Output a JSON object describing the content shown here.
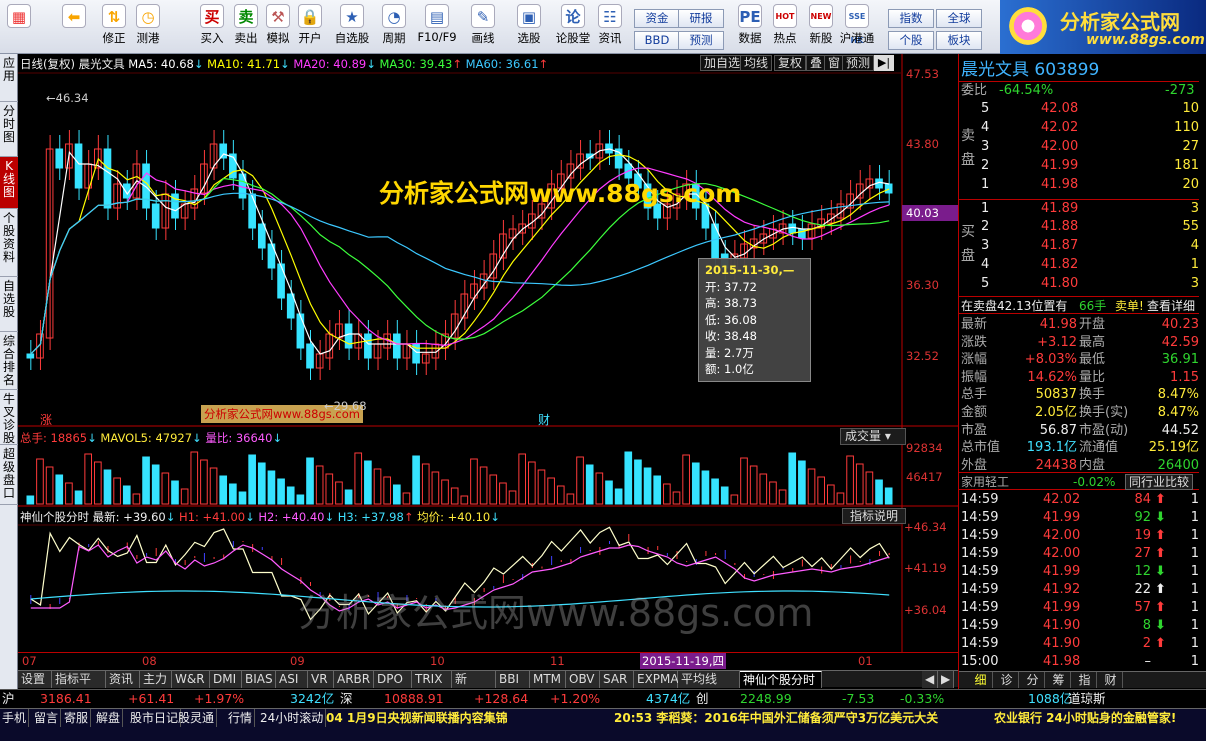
{
  "toolbar": {
    "buttons": [
      {
        "label": "",
        "icon": "app-grid-icon"
      },
      {
        "label": "",
        "icon": "back-arrow-icon"
      },
      {
        "label": "修正",
        "icon": "up-down-icon"
      },
      {
        "label": "测港",
        "icon": "clock-icon"
      },
      {
        "label": "买入",
        "icon": "buy-icon",
        "glyph": "买"
      },
      {
        "label": "卖出",
        "icon": "sell-icon",
        "glyph": "卖"
      },
      {
        "label": "模拟",
        "icon": "hammer-icon"
      },
      {
        "label": "开户",
        "icon": "lock-icon"
      },
      {
        "label": "自选股",
        "icon": "star-icon"
      },
      {
        "label": "周期",
        "icon": "cycle-icon"
      },
      {
        "label": "F10/F9",
        "icon": "f10-icon"
      },
      {
        "label": "画线",
        "icon": "pen-icon"
      },
      {
        "label": "选股",
        "icon": "monitor-icon"
      },
      {
        "label": "论股堂",
        "icon": "forum-icon",
        "glyph": "论"
      },
      {
        "label": "资讯",
        "icon": "news-icon"
      },
      {
        "label": "数据",
        "icon": "pe-icon",
        "glyph": "PE"
      },
      {
        "label": "热点",
        "icon": "hot-icon",
        "glyph": "HOT"
      },
      {
        "label": "新股",
        "icon": "new-stock-icon",
        "glyph": "NEW"
      },
      {
        "label": "沪港通",
        "icon": "sse-hk-icon",
        "glyph": "SSE HK"
      }
    ],
    "small_buttons": [
      "资金",
      "BBD",
      "研报",
      "预测",
      "指数",
      "个股",
      "全球",
      "板块"
    ]
  },
  "logo": {
    "title": "分析家公式网",
    "url": "www.88gs.com"
  },
  "left_tabs": [
    "应用",
    "分时图",
    "K线图",
    "个股资料",
    "自选股",
    "综合排名",
    "牛叉诊股",
    "超级盘口"
  ],
  "main_chart": {
    "header": {
      "period": "日线(复权)",
      "stock": "晨光文具",
      "ma5": "MA5: 40.68",
      "ma10": "MA10: 41.71",
      "ma20": "MA20: 40.89",
      "ma30": "MA30: 39.43",
      "ma60": "MA60: 36.61"
    },
    "buttons": [
      "加自选",
      "均线",
      "复权",
      "叠",
      "窗",
      "预测"
    ],
    "y_labels": [
      "47.53",
      "43.80",
      "40.03",
      "36.30",
      "32.52"
    ],
    "current_price": "40.03",
    "high_mark": "46.34",
    "low_mark": "29.68",
    "watermark": "分析家公式网www.88gs.com",
    "badge_watermark": "分析家公式网www.88gs.com",
    "marks": [
      "涨",
      "财"
    ],
    "tooltip": {
      "date": "2015-11-30,—",
      "open": "开: 37.72",
      "high": "高: 38.73",
      "low": "低: 36.08",
      "close": "收: 38.48",
      "volume": "量: 2.7万",
      "amount": "额: 1.0亿"
    }
  },
  "volume_panel": {
    "header_total": "总手: 18865",
    "header_mavol": "MAVOL5: 47927",
    "header_ratio": "量比: 36640",
    "dropdown": "成交量",
    "y_labels": [
      "92834",
      "46417"
    ]
  },
  "indicator_panel": {
    "name": "神仙个股分时 最新: +39.60",
    "h1": "H1: +41.00",
    "h2": "H2: +40.40",
    "h3": "H3: +37.98",
    "avg": "均价: +40.10",
    "help": "指标说明",
    "y_labels": [
      "+46.34",
      "+41.19",
      "+36.04"
    ],
    "watermark": "分析家公式网www.88gs.com"
  },
  "x_axis": {
    "labels": [
      "07",
      "08",
      "09",
      "10",
      "11",
      "01"
    ],
    "highlight": "2015-11-19,四"
  },
  "bottom_tabs": [
    "设置",
    "指标平台",
    "资讯",
    "主力",
    "W&R",
    "DMI",
    "BIAS",
    "ASI",
    "VR",
    "ARBR",
    "DPO",
    "TRIX",
    "新DMA",
    "BBI",
    "MTM",
    "OBV",
    "SAR",
    "EXPMA",
    "平均线ZZJ",
    "神仙个股分时"
  ],
  "right_panel": {
    "title": "晨光文具",
    "code": "603899",
    "weibi_label": "委比",
    "weibi": "-64.54%",
    "weicha": "-273",
    "sell_label": "卖盘",
    "buy_label": "买盘",
    "sells": [
      {
        "lvl": "5",
        "price": "42.08",
        "vol": "10"
      },
      {
        "lvl": "4",
        "price": "42.02",
        "vol": "110"
      },
      {
        "lvl": "3",
        "price": "42.00",
        "vol": "27"
      },
      {
        "lvl": "2",
        "price": "41.99",
        "vol": "181"
      },
      {
        "lvl": "1",
        "price": "41.98",
        "vol": "20"
      }
    ],
    "buys": [
      {
        "lvl": "1",
        "price": "41.89",
        "vol": "3"
      },
      {
        "lvl": "2",
        "price": "41.88",
        "vol": "55"
      },
      {
        "lvl": "3",
        "price": "41.87",
        "vol": "4"
      },
      {
        "lvl": "4",
        "price": "41.82",
        "vol": "1"
      },
      {
        "lvl": "5",
        "price": "41.80",
        "vol": "3"
      }
    ],
    "inline_info": "在卖盘42.13位置有",
    "inline_vol": "66手",
    "inline_action": "卖单!",
    "inline_link": "查看详细",
    "quotes": [
      {
        "l1": "最新",
        "v1": "41.98",
        "l2": "开盘",
        "v2": "40.23"
      },
      {
        "l1": "涨跌",
        "v1": "+3.12",
        "l2": "最高",
        "v2": "42.59"
      },
      {
        "l1": "涨幅",
        "v1": "+8.03%",
        "l2": "最低",
        "v2": "36.91"
      },
      {
        "l1": "振幅",
        "v1": "14.62%",
        "l2": "量比",
        "v2": "1.15"
      },
      {
        "l1": "总手",
        "v1": "50837",
        "l2": "换手",
        "v2": "8.47%"
      },
      {
        "l1": "金额",
        "v1": "2.05亿",
        "l2": "换手(实)",
        "v2": "8.47%"
      },
      {
        "l1": "市盈",
        "v1": "56.87",
        "l2": "市盈(动)",
        "v2": "44.52"
      },
      {
        "l1": "总市值",
        "v1": "193.1亿",
        "l2": "流通值",
        "v2": "25.19亿"
      },
      {
        "l1": "外盘",
        "v1": "24438",
        "l2": "内盘",
        "v2": "26400"
      }
    ],
    "industry": "家用轻工",
    "industry_change": "-0.02%",
    "industry_compare": "同行业比较",
    "ticks": [
      {
        "t": "14:59",
        "p": "42.02",
        "v": "84",
        "dir": "up",
        "n": "1"
      },
      {
        "t": "14:59",
        "p": "41.99",
        "v": "92",
        "dir": "down",
        "n": "1"
      },
      {
        "t": "14:59",
        "p": "42.00",
        "v": "19",
        "dir": "up",
        "n": "1"
      },
      {
        "t": "14:59",
        "p": "42.00",
        "v": "27",
        "dir": "up",
        "n": "1"
      },
      {
        "t": "14:59",
        "p": "41.99",
        "v": "12",
        "dir": "down",
        "n": "1"
      },
      {
        "t": "14:59",
        "p": "41.92",
        "v": "22",
        "dir": "white",
        "n": "1"
      },
      {
        "t": "14:59",
        "p": "41.99",
        "v": "57",
        "dir": "up",
        "n": "1"
      },
      {
        "t": "14:59",
        "p": "41.90",
        "v": "8",
        "dir": "down",
        "n": "1"
      },
      {
        "t": "14:59",
        "p": "41.90",
        "v": "2",
        "dir": "up",
        "n": "1"
      },
      {
        "t": "15:00",
        "p": "41.98",
        "v": "–",
        "dir": "none",
        "n": "1"
      }
    ],
    "bottom_tabs": [
      "细",
      "诊",
      "分",
      "筹",
      "指",
      "财"
    ]
  },
  "index_bar": {
    "sh_label": "沪",
    "sh": "3186.41",
    "sh_chg": "+61.41",
    "sh_pct": "+1.97%",
    "sh_amt": "3242亿",
    "sz_label": "深",
    "sz": "10888.91",
    "sz_chg": "+128.64",
    "sz_pct": "+1.20%",
    "sz_amt": "4374亿",
    "cy_label": "创",
    "cy": "2248.99",
    "cy_chg": "-7.53",
    "cy_pct": "-0.33%",
    "cy_amt": "1088亿",
    "extra": "道琼斯"
  },
  "status_bar": {
    "items": [
      "手机",
      "留言",
      "寄服",
      "解盘",
      "股市日记",
      "股灵通",
      "行情",
      "24小时滚动"
    ],
    "news1": "04 1月9日央视新闻联播内容集锦",
    "news2": "20:53 李稻葵：2016年中国外汇储备须严守3万亿美元大关",
    "news3": "农业银行 24小时贴身的金融管家!"
  },
  "colors": {
    "ma5": "#ffffff",
    "ma10": "#ffff00",
    "ma20": "#ff3cff",
    "ma30": "#3cff3c",
    "ma60": "#3cc8ff",
    "up": "#ff3b3b",
    "down": "#36e3ff",
    "panel_border": "#b00000"
  }
}
